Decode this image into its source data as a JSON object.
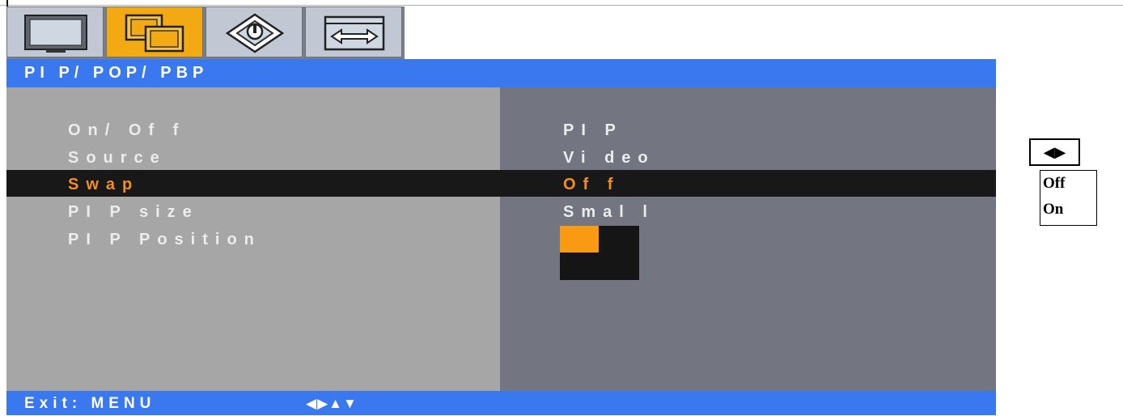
{
  "tabs": [
    {
      "name": "picture",
      "icon": "monitor-icon",
      "active": false
    },
    {
      "name": "pip",
      "icon": "pip-windows-icon",
      "active": true
    },
    {
      "name": "setup",
      "icon": "settings-icon",
      "active": false
    },
    {
      "name": "aspect",
      "icon": "resize-icon",
      "active": false
    }
  ],
  "menu": {
    "title": "PI P/ POP/ PBP",
    "items": [
      {
        "label": "On/ Of f",
        "value": "PI P"
      },
      {
        "label": "Source",
        "value": "Vi deo"
      },
      {
        "label": "Swap",
        "value": "Of f",
        "selected": true
      },
      {
        "label": "PI P size",
        "value": "Smal l"
      },
      {
        "label": "PI P Position",
        "value": "top-left"
      }
    ]
  },
  "footer": {
    "exit_text": "Exit: MENU",
    "nav_arrows": "◀▶▲▼"
  },
  "side": {
    "lr_button": "◀▶",
    "options": [
      "Off",
      "On"
    ]
  },
  "colors": {
    "header_blue": "#3a78ef",
    "active_tab": "#f3aa12",
    "selection_text": "#f58f1a",
    "pip_quadrant": "#f89b12"
  }
}
